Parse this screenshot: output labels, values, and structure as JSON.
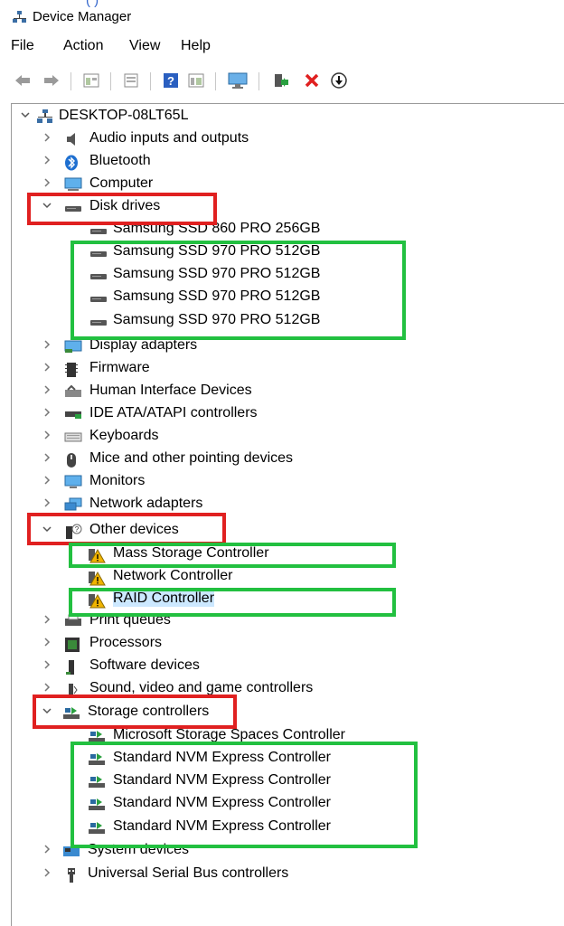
{
  "window": {
    "title": "Device Manager",
    "top_clip_text": "(  )"
  },
  "menu": [
    "File",
    "Action",
    "View",
    "Help"
  ],
  "toolbar": {
    "icons": [
      "back-arrow-icon",
      "forward-arrow-icon",
      "properties-icon",
      "show-hide-icon",
      "help-icon",
      "view-icon",
      "monitor-icon",
      "update-driver-icon",
      "uninstall-icon",
      "enable-device-icon"
    ]
  },
  "tree": {
    "root": "DESKTOP-08LT65L",
    "items": [
      {
        "label": "Audio inputs and outputs",
        "icon": "speaker-icon"
      },
      {
        "label": "Bluetooth",
        "icon": "bluetooth-icon"
      },
      {
        "label": "Computer",
        "icon": "computer-icon"
      },
      {
        "label": "Disk drives",
        "icon": "drive-icon",
        "expanded": true,
        "children": [
          "Samsung SSD 860 PRO 256GB",
          "Samsung SSD 970 PRO 512GB",
          "Samsung SSD 970 PRO 512GB",
          "Samsung SSD 970 PRO 512GB",
          "Samsung SSD 970 PRO 512GB"
        ]
      },
      {
        "label": "Display adapters",
        "icon": "display-adapter-icon"
      },
      {
        "label": "Firmware",
        "icon": "firmware-icon"
      },
      {
        "label": "Human Interface Devices",
        "icon": "hid-icon"
      },
      {
        "label": "IDE ATA/ATAPI controllers",
        "icon": "ide-icon"
      },
      {
        "label": "Keyboards",
        "icon": "keyboard-icon"
      },
      {
        "label": "Mice and other pointing devices",
        "icon": "mouse-icon"
      },
      {
        "label": "Monitors",
        "icon": "monitor-icon"
      },
      {
        "label": "Network adapters",
        "icon": "network-icon"
      },
      {
        "label": "Other devices",
        "icon": "unknown-device-icon",
        "expanded": true,
        "children": [
          "Mass Storage Controller",
          "Network Controller",
          "RAID Controller"
        ]
      },
      {
        "label": "Print queues",
        "icon": "printer-icon"
      },
      {
        "label": "Processors",
        "icon": "processor-icon"
      },
      {
        "label": "Software devices",
        "icon": "software-device-icon"
      },
      {
        "label": "Sound, video and game controllers",
        "icon": "sound-icon"
      },
      {
        "label": "Storage controllers",
        "icon": "storage-controller-icon",
        "expanded": true,
        "children": [
          "Microsoft Storage Spaces Controller",
          "Standard NVM Express Controller",
          "Standard NVM Express Controller",
          "Standard NVM Express Controller",
          "Standard NVM Express Controller"
        ]
      },
      {
        "label": "System devices",
        "icon": "system-devices-icon"
      },
      {
        "label": "Universal Serial Bus controllers",
        "icon": "usb-icon"
      }
    ]
  },
  "selected_item": "RAID Controller",
  "colors": {
    "annotation_red": "#e02020",
    "annotation_green": "#22c040",
    "selection": "#cce8ff",
    "warning": "#f0b400"
  }
}
